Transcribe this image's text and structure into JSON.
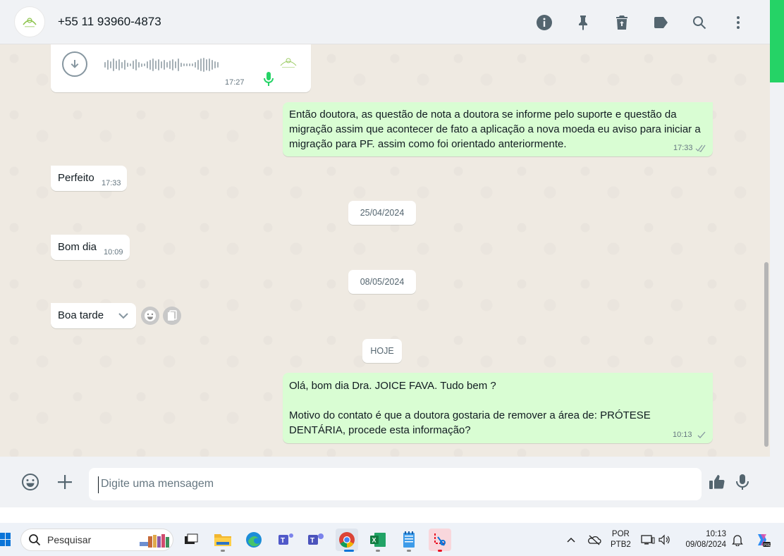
{
  "header": {
    "contact_name": "+55 11 93960-4873",
    "icons": [
      "info-icon",
      "pin-icon",
      "delete-icon",
      "label-icon",
      "search-icon",
      "menu-icon"
    ]
  },
  "messages": {
    "audio": {
      "time": "17:27"
    },
    "m1": {
      "text": "Então doutora, as questão de nota a doutora se informe pelo suporte e questão da migração assim que acontecer de fato a aplicação a nova moeda eu aviso para iniciar a migração para PF. assim como foi orientado anteriormente.",
      "time": "17:33"
    },
    "m2": {
      "text": "Perfeito",
      "time": "17:33"
    },
    "d1": "25/04/2024",
    "m3": {
      "text": "Bom dia",
      "time": "10:09"
    },
    "d2": "08/05/2024",
    "m4": {
      "text": "Boa tarde"
    },
    "d3": "HOJE",
    "m5": {
      "line1": "Olá, bom dia Dra. JOICE FAVA. Tudo bem ?",
      "line2": "Motivo do contato é que a doutora gostaria de remover a área de: PRÓTESE DENTÁRIA, procede esta informação?",
      "time": "10:13"
    }
  },
  "composer": {
    "placeholder": "Digite uma mensagem"
  },
  "taskbar": {
    "search_label": "Pesquisar",
    "lang_top": "POR",
    "lang_bottom": "PTB2",
    "clock_time": "10:13",
    "clock_date": "09/08/2024"
  },
  "colors": {
    "outgoing": "#d9fdd3",
    "incoming": "#ffffff",
    "accent": "#25d366"
  }
}
